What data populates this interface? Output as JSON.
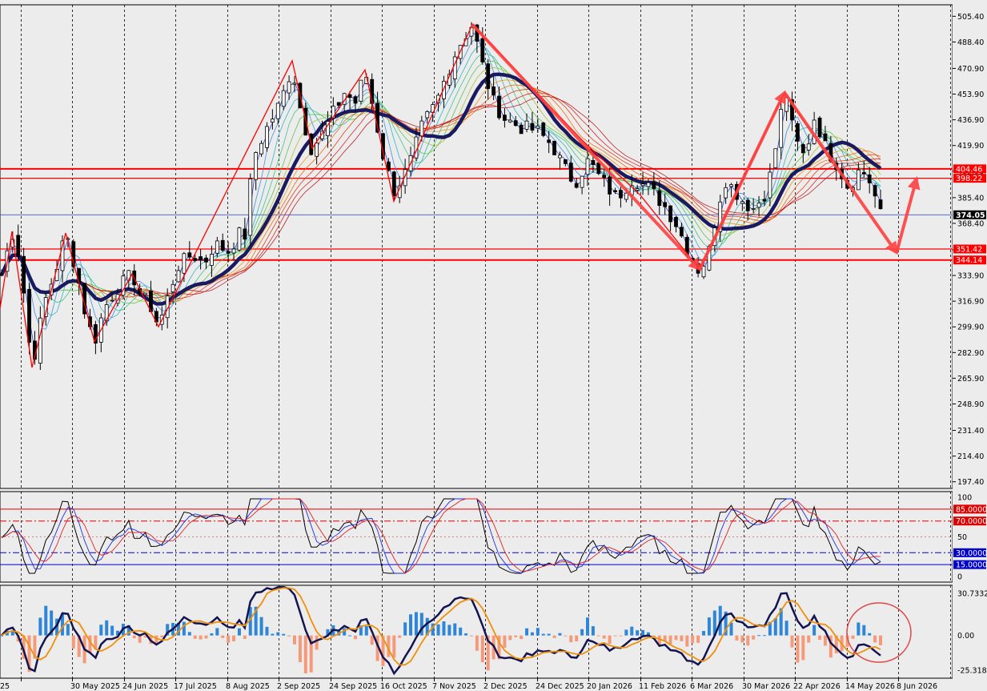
{
  "chart_data": {
    "type": "candlestick",
    "price_axis": {
      "range": [
        193.0,
        513.0
      ],
      "ticks": [
        "505.40",
        "488.40",
        "470.90",
        "453.90",
        "436.90",
        "419.90",
        "402.90",
        "385.40",
        "368.40",
        "350.90",
        "333.90",
        "316.90",
        "299.90",
        "282.90",
        "265.90",
        "248.90",
        "231.40",
        "214.40",
        "197.40"
      ]
    },
    "date_axis": {
      "labels": [
        "25",
        "30 May 2025",
        "24 Jun 2025",
        "17 Jul 2025",
        "8 Aug 2025",
        "2 Sep 2025",
        "24 Sep 2025",
        "16 Oct 2025",
        "7 Nov 2025",
        "2 Dec 2025",
        "24 Dec 2025",
        "20 Jan 2026",
        "11 Feb 2026",
        "6 Mar 2026",
        "30 Mar 2026",
        "22 Apr 2026",
        "14 May 2026",
        "8 Jun 2026"
      ]
    },
    "horizontal_levels": [
      {
        "label": "404.46",
        "value": 404.46,
        "color": "#ff0000"
      },
      {
        "label": "398.22",
        "value": 398.22,
        "color": "#ff0000"
      },
      {
        "label": "351.42",
        "value": 351.42,
        "color": "#ff0000"
      },
      {
        "label": "344.14",
        "value": 344.14,
        "color": "#ff0000"
      }
    ],
    "current_price": {
      "label": "374.05",
      "value": 374.05
    },
    "price_path": [
      [
        0,
        330
      ],
      [
        15,
        363
      ],
      [
        25,
        345
      ],
      [
        40,
        273
      ],
      [
        55,
        315
      ],
      [
        70,
        338
      ],
      [
        82,
        362
      ],
      [
        95,
        338
      ],
      [
        108,
        305
      ],
      [
        118,
        290
      ],
      [
        130,
        312
      ],
      [
        145,
        325
      ],
      [
        160,
        332
      ],
      [
        165,
        335
      ],
      [
        175,
        322
      ],
      [
        190,
        312
      ],
      [
        198,
        300
      ],
      [
        210,
        320
      ],
      [
        222,
        340
      ],
      [
        240,
        348
      ],
      [
        255,
        342
      ],
      [
        268,
        355
      ],
      [
        285,
        350
      ],
      [
        300,
        362
      ],
      [
        308,
        360
      ],
      [
        315,
        410
      ],
      [
        330,
        428
      ],
      [
        350,
        448
      ],
      [
        365,
        472
      ],
      [
        375,
        445
      ],
      [
        388,
        418
      ],
      [
        400,
        425
      ],
      [
        415,
        440
      ],
      [
        430,
        455
      ],
      [
        445,
        448
      ],
      [
        456,
        470
      ],
      [
        468,
        440
      ],
      [
        480,
        410
      ],
      [
        492,
        390
      ],
      [
        505,
        400
      ],
      [
        515,
        412
      ],
      [
        525,
        430
      ],
      [
        535,
        440
      ],
      [
        545,
        448
      ],
      [
        560,
        470
      ],
      [
        572,
        485
      ],
      [
        590,
        500
      ],
      [
        600,
        478
      ],
      [
        615,
        450
      ],
      [
        630,
        438
      ],
      [
        650,
        432
      ],
      [
        670,
        430
      ],
      [
        690,
        420
      ],
      [
        705,
        405
      ],
      [
        718,
        395
      ],
      [
        735,
        410
      ],
      [
        750,
        398
      ],
      [
        770,
        385
      ],
      [
        790,
        398
      ],
      [
        810,
        392
      ],
      [
        830,
        380
      ],
      [
        845,
        368
      ],
      [
        858,
        352
      ],
      [
        872,
        338
      ],
      [
        884,
        345
      ],
      [
        895,
        375
      ],
      [
        905,
        398
      ],
      [
        918,
        390
      ],
      [
        930,
        382
      ],
      [
        942,
        378
      ],
      [
        955,
        388
      ],
      [
        965,
        405
      ],
      [
        975,
        440
      ],
      [
        982,
        455
      ],
      [
        992,
        425
      ],
      [
        1005,
        412
      ],
      [
        1018,
        440
      ],
      [
        1030,
        420
      ],
      [
        1045,
        408
      ],
      [
        1060,
        392
      ],
      [
        1075,
        405
      ],
      [
        1088,
        395
      ],
      [
        1100,
        374
      ]
    ],
    "zigzag": [
      [
        0,
        312
      ],
      [
        15,
        363
      ],
      [
        40,
        273
      ],
      [
        82,
        362
      ],
      [
        118,
        290
      ],
      [
        165,
        335
      ],
      [
        198,
        300
      ],
      [
        365,
        476
      ],
      [
        390,
        418
      ],
      [
        456,
        470
      ],
      [
        492,
        383
      ],
      [
        590,
        500
      ],
      [
        728,
        423
      ],
      [
        800,
        387
      ],
      [
        874,
        338
      ],
      [
        980,
        455
      ],
      [
        1040,
        408
      ]
    ],
    "forecast_arrows": [
      [
        [
          590,
          500
        ],
        [
          874,
          338
        ]
      ],
      [
        [
          874,
          338
        ],
        [
          980,
          455
        ]
      ],
      [
        [
          980,
          455
        ],
        [
          1120,
          349
        ]
      ],
      [
        [
          1120,
          349
        ],
        [
          1145,
          398
        ]
      ]
    ],
    "oscillator_1": {
      "range": [
        0,
        100
      ],
      "ticks": [
        "100",
        "50",
        "0"
      ],
      "levels": [
        {
          "label": "85.0000",
          "value": 85,
          "color": "#dd0000",
          "style": "solid"
        },
        {
          "label": "70.0000",
          "value": 70,
          "color": "#dd0000",
          "style": "dashdot"
        },
        {
          "label": "30.0000",
          "value": 30,
          "color": "#0000cc",
          "style": "dashdot"
        },
        {
          "label": "15.0000",
          "value": 15,
          "color": "#0000cc",
          "style": "solid"
        }
      ]
    },
    "oscillator_2": {
      "range": [
        -25.3185,
        30.7332
      ],
      "ticks": [
        "30.7332",
        "0.00",
        "-25.3185"
      ]
    },
    "annotation": {
      "shape": "ellipse",
      "note": "oscillator turning point"
    }
  }
}
